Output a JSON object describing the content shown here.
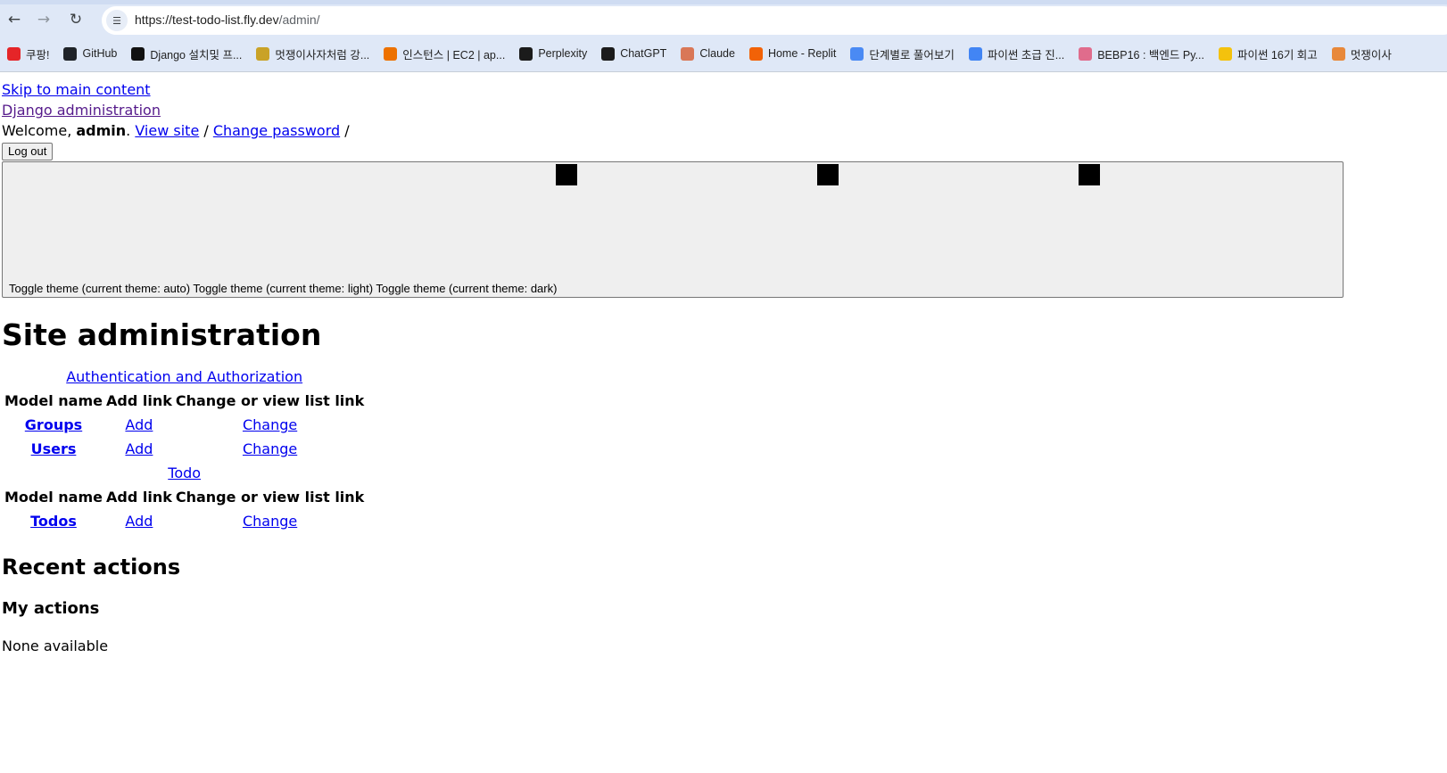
{
  "browser": {
    "url_host": "https://test-todo-list.fly.dev",
    "url_path": "/admin/",
    "bookmarks": [
      {
        "label": "쿠팡!",
        "icon": "coupang-icon",
        "color": "#e52528"
      },
      {
        "label": "GitHub",
        "icon": "github-icon",
        "color": "#1f2328"
      },
      {
        "label": "Django 설치및 프...",
        "icon": "notion-icon",
        "color": "#111111"
      },
      {
        "label": "멋쟁이사자처럼 강...",
        "icon": "lion-image-icon",
        "color": "#c9a227"
      },
      {
        "label": "인스턴스 | EC2 | ap...",
        "icon": "aws-icon",
        "color": "#ed7100"
      },
      {
        "label": "Perplexity",
        "icon": "perplexity-icon",
        "color": "#1b1b1b"
      },
      {
        "label": "ChatGPT",
        "icon": "chatgpt-icon",
        "color": "#1b1b1b"
      },
      {
        "label": "Claude",
        "icon": "claude-icon",
        "color": "#d97757"
      },
      {
        "label": "Home - Replit",
        "icon": "replit-icon",
        "color": "#f26207"
      },
      {
        "label": "단계별로 풀어보기",
        "icon": "code-icon",
        "color": "#4a8af4"
      },
      {
        "label": "파이썬 초급 진...",
        "icon": "docs-icon",
        "color": "#4285f4"
      },
      {
        "label": "BEBP16 : 백엔드 Py...",
        "icon": "flower-icon",
        "color": "#e06c8c"
      },
      {
        "label": "파이썬 16기 회고",
        "icon": "smile-icon",
        "color": "#f4c20d"
      },
      {
        "label": "멋쟁이사",
        "icon": "lion-icon",
        "color": "#e8883a"
      }
    ]
  },
  "header": {
    "skip_link": "Skip to main content",
    "branding": "Django administration",
    "welcome_prefix": "Welcome, ",
    "username": "admin",
    "welcome_dot": ". ",
    "view_site": "View site",
    "sep1": " / ",
    "change_password": "Change password",
    "sep2": " /",
    "logout": "Log out"
  },
  "theme_toggle": {
    "text": "Toggle theme (current theme: auto) Toggle theme (current theme: light) Toggle theme (current theme: dark)"
  },
  "main": {
    "title": "Site administration",
    "apps": [
      {
        "caption": "Authentication and Authorization",
        "headers": [
          "Model name",
          "Add link",
          "Change or view list link"
        ],
        "models": [
          {
            "name": "Groups",
            "add": "Add",
            "change": "Change"
          },
          {
            "name": "Users",
            "add": "Add",
            "change": "Change"
          }
        ]
      },
      {
        "caption": "Todo",
        "headers": [
          "Model name",
          "Add link",
          "Change or view list link"
        ],
        "models": [
          {
            "name": "Todos",
            "add": "Add",
            "change": "Change"
          }
        ]
      }
    ]
  },
  "recent": {
    "title": "Recent actions",
    "my_actions": "My actions",
    "empty": "None available"
  }
}
